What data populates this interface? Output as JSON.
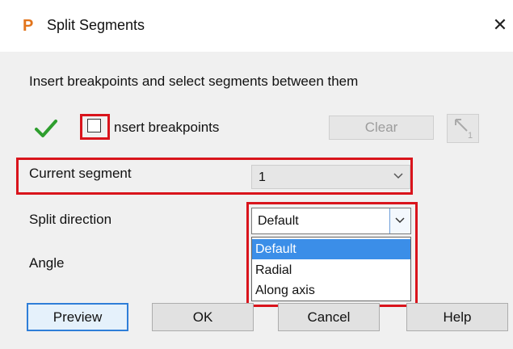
{
  "window": {
    "title": "Split Segments",
    "app_icon_letter": "P",
    "app_icon_color": "#e2741b",
    "close_glyph": "✕"
  },
  "instruction": "Insert breakpoints and select segments between them",
  "breakpoints": {
    "status_icon": "check-icon",
    "checkbox_checked": false,
    "checkbox_label": "nsert breakpoints",
    "clear_label": "Clear",
    "pick_icon": "pick-segment-icon",
    "pick_icon_subscript": "1"
  },
  "current_segment": {
    "label": "Current segment",
    "value": "1"
  },
  "split_direction": {
    "label": "Split direction",
    "value": "Default",
    "options": [
      "Default",
      "Radial",
      "Along axis"
    ],
    "selected_index": 0
  },
  "angle": {
    "label": "Angle"
  },
  "buttons": {
    "preview": "Preview",
    "ok": "OK",
    "cancel": "Cancel",
    "help": "Help"
  },
  "colors": {
    "highlight": "#d9141c",
    "selection": "#3b8ee8",
    "check": "#2e9e2e"
  }
}
